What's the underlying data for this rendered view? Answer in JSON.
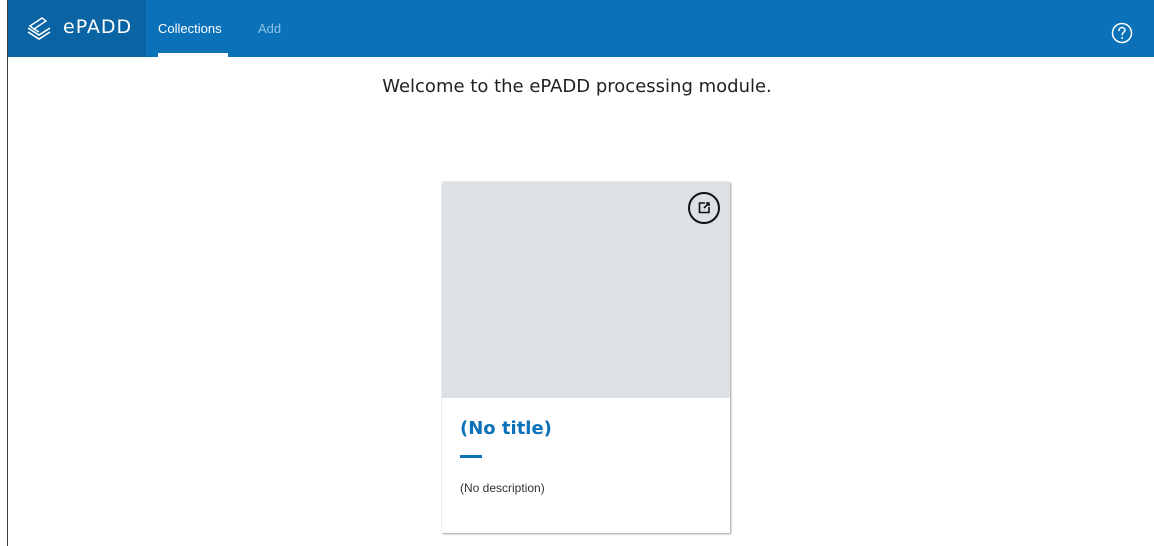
{
  "header": {
    "brand_name": "ePADD",
    "nav": [
      {
        "label": "Collections",
        "active": true
      },
      {
        "label": "Add",
        "active": false
      }
    ],
    "help_icon": "help-circle-icon"
  },
  "main": {
    "welcome_text": "Welcome to the ePADD processing module."
  },
  "collections": [
    {
      "title": "(No title)",
      "description": "(No description)",
      "open_icon": "open-external-icon"
    }
  ],
  "colors": {
    "navbar": "#0b72b9",
    "brand_bg": "#0a64a4",
    "card_image_bg": "#dce1e5",
    "title": "#0b72b9"
  }
}
